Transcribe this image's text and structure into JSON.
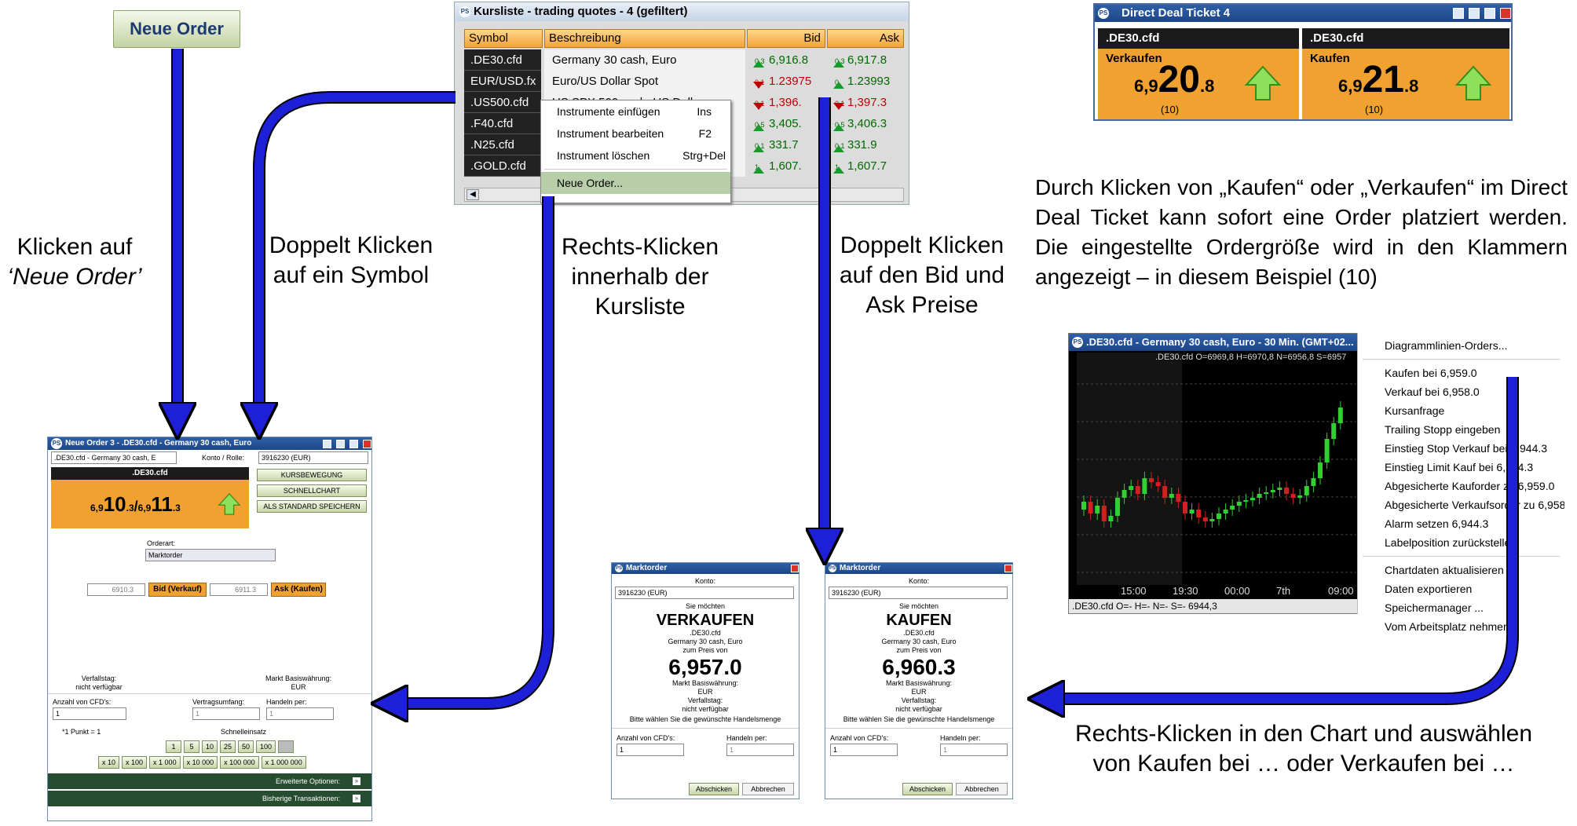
{
  "neue_order_button": "Neue Order",
  "captions": {
    "klick_neue_order_1": "Klicken auf",
    "klick_neue_order_2": "‘Neue Order’",
    "doppelt_symbol_1": "Doppelt Klicken",
    "doppelt_symbol_2": "auf ein Symbol",
    "rechts_kursliste_1": "Rechts-Klicken",
    "rechts_kursliste_2": "innerhalb der",
    "rechts_kursliste_3": "Kursliste",
    "doppelt_bidask_1": "Doppelt Klicken",
    "doppelt_bidask_2": "auf den Bid und",
    "doppelt_bidask_3": "Ask Preise",
    "chart_1": "Rechts-Klicken in den Chart und auswählen",
    "chart_2": "von Kaufen bei … oder Verkaufen bei …"
  },
  "ddt_text": "Durch Klicken von „Kaufen“ oder „Verkaufen“ im Direct Deal Ticket kann sofort eine Order platziert werden. Die eingestellte Ordergröße wird in den Klammern angezeigt – in diesem Beispiel (10)",
  "kursliste": {
    "title": "Kursliste - trading quotes - 4 (gefiltert)",
    "headers": {
      "symbol": "Symbol",
      "desc": "Beschreibung",
      "bid": "Bid",
      "ask": "Ask"
    },
    "rows": [
      {
        "symbol": ".DE30.cfd",
        "desc": "Germany 30 cash, Euro",
        "bid_small": "0.3",
        "bid": "6,916.8",
        "ask_small": "0.3",
        "ask": "6,917.8",
        "dir": "up"
      },
      {
        "symbol": "EUR/USD.fx",
        "desc": "Euro/US Dollar Spot",
        "bid_small": "0.1",
        "bid": "1.23975",
        "ask_small": "0",
        "ask": "1.23993",
        "dir": "mixed"
      },
      {
        "symbol": ".US500.cfd",
        "desc": "US SPX 500 cash, US Dolla",
        "bid_small": "0.1",
        "bid": "1,396.",
        "ask_small": "0.1",
        "ask": "1,397.3",
        "dir": "dn"
      },
      {
        "symbol": ".F40.cfd",
        "desc": "",
        "bid_small": "0.5",
        "bid": "3,405.",
        "ask_small": "0.5",
        "ask": "3,406.3",
        "dir": "up"
      },
      {
        "symbol": ".N25.cfd",
        "desc": "",
        "bid_small": "0.1",
        "bid": "331.7",
        "ask_small": "0.1",
        "ask": "331.9",
        "dir": "up"
      },
      {
        "symbol": ".GOLD.cfd",
        "desc": "",
        "bid_small": "1",
        "bid": "1,607.",
        "ask_small": "1",
        "ask": "1,607.7",
        "dir": "up"
      }
    ],
    "context_menu": [
      {
        "label": "Instrumente einfügen",
        "shortcut": "Ins"
      },
      {
        "label": "Instrument bearbeiten",
        "shortcut": "F2"
      },
      {
        "label": "Instrument löschen",
        "shortcut": "Strg+Del"
      },
      {
        "label": "Neue Order...",
        "shortcut": ""
      }
    ]
  },
  "ddt": {
    "title": "Direct Deal Ticket 4",
    "sell": {
      "symbol": ".DE30.cfd",
      "label": "Verkaufen",
      "pre": "6,9",
      "big": "20",
      "post": ".8",
      "qty": "(10)"
    },
    "buy": {
      "symbol": ".DE30.cfd",
      "label": "Kaufen",
      "pre": "6,9",
      "big": "21",
      "post": ".8",
      "qty": "(10)"
    }
  },
  "chart": {
    "title": ".DE30.cfd - Germany 30 cash, Euro - 30 Min. (GMT+02...",
    "ohlc": ".DE30.cfd O=6969,8 H=6970,8 N=6956,8 S=6957",
    "xlabels": [
      "15:00",
      "19:30",
      "00:00",
      "7th",
      "09:00"
    ],
    "status": ".DE30.cfd O=- H=- N=- S=-   6944,3",
    "menu": [
      "Diagrammlinien-Orders...",
      "Kaufen bei 6,959.0",
      "Verkauf bei 6,958.0",
      "Kursanfrage",
      "Trailing Stopp eingeben",
      "Einstieg Stop Verkauf bei 6,944.3",
      "Einstieg Limit Kauf bei 6,944.3",
      "Abgesicherte Kauforder zu 6,959.0",
      "Abgesicherte Verkaufsorder zu 6,958.0",
      "Alarm setzen 6,944.3",
      "Labelposition zurückstellen",
      "Chartdaten aktualisieren",
      "Daten exportieren",
      "Speichermanager ...",
      "Vom Arbeitsplatz nehmen"
    ]
  },
  "neue_order": {
    "title": "Neue Order 3 - .DE30.cfd - Germany 30 cash, Euro",
    "instrument": ".DE30.cfd - Germany 30 cash, E",
    "konto_label": "Konto / Rolle:",
    "konto": "3916230 (EUR)",
    "symbol": ".DE30.cfd",
    "bid_pre": "6,9",
    "bid_big": "10",
    "bid_post": ".3",
    "ask_pre": "6,9",
    "ask_big": "11",
    "ask_post": ".3",
    "btn_kurs": "KURSBEWEGUNG",
    "btn_chart": "SCHNELLCHART",
    "btn_std": "ALS STANDARD SPEICHERN",
    "orderart_label": "Orderart:",
    "orderart": "Marktorder",
    "bid_input": "6910.3",
    "ask_input": "6911.3",
    "bid_btn": "Bid (Verkauf)",
    "ask_btn": "Ask (Kaufen)",
    "verfall_label": "Verfallstag:",
    "verfall": "nicht verfügbar",
    "markt_label": "Markt Basiswährung:",
    "markt": "EUR",
    "anzahl_label": "Anzahl von CFD's:",
    "anzahl": "1",
    "vertrag_label": "Vertragsumfang:",
    "vertrag": "1",
    "handeln_label": "Handeln per:",
    "handeln": "1",
    "punkt": "*1 Punkt = 1",
    "schnell_label": "Schnelleinsatz",
    "quick1": [
      "1",
      "5",
      "10",
      "25",
      "50",
      "100",
      ""
    ],
    "quick2": [
      "x 10",
      "x 100",
      "x 1 000",
      "x 10 000",
      "x 100 000",
      "x 1 000 000"
    ],
    "erweitert": "Erweiterte Optionen:",
    "bisherige": "Bisherige Transaktionen:"
  },
  "marktorder_sell": {
    "title": "Marktorder",
    "konto_label": "Konto:",
    "konto": "3916230 (EUR)",
    "sie": "Sie möchten",
    "action": "VERKAUFEN",
    "symbol": ".DE30.cfd",
    "desc": "Germany 30 cash, Euro",
    "zum": "zum Preis von",
    "price": "6,957.0",
    "markt_label": "Markt Basiswährung:",
    "markt": "EUR",
    "verfall_label": "Verfallstag:",
    "verfall": "nicht verfügbar",
    "hinweis": "Bitte wählen Sie die gewünschte Handelsmenge",
    "anzahl_label": "Anzahl von CFD's:",
    "anzahl": "1",
    "handeln_label": "Handeln per:",
    "handeln": "1",
    "btn_ok": "Abschicken",
    "btn_cancel": "Abbrechen"
  },
  "marktorder_buy": {
    "title": "Marktorder",
    "konto_label": "Konto:",
    "konto": "3916230 (EUR)",
    "sie": "Sie möchten",
    "action": "KAUFEN",
    "symbol": ".DE30.cfd",
    "desc": "Germany 30 cash, Euro",
    "zum": "zum Preis von",
    "price": "6,960.3",
    "markt_label": "Markt Basiswährung:",
    "markt": "EUR",
    "verfall_label": "Verfallstag:",
    "verfall": "nicht verfügbar",
    "hinweis": "Bitte wählen Sie die gewünschte Handelsmenge",
    "anzahl_label": "Anzahl von CFD's:",
    "anzahl": "1",
    "handeln_label": "Handeln per:",
    "handeln": "1",
    "btn_ok": "Abschicken",
    "btn_cancel": "Abbrechen"
  },
  "colors": {
    "arrow": "#1e20d8",
    "orange": "#f0a130",
    "green": "#274d30"
  }
}
